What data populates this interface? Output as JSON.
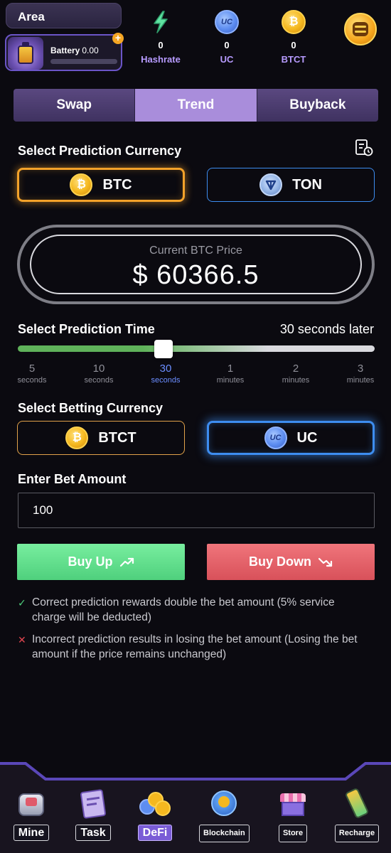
{
  "header": {
    "area_label": "Area",
    "battery_label": "Battery",
    "battery_value": "0.00",
    "stats": [
      {
        "value": "0",
        "label": "Hashrate",
        "icon": "hashrate-bolt-icon"
      },
      {
        "value": "0",
        "label": "UC",
        "icon": "uc-coin-icon",
        "coin_text": "UC"
      },
      {
        "value": "0",
        "label": "BTCT",
        "icon": "btct-coin-icon",
        "coin_text": "₿"
      }
    ],
    "accent_color": "#b79bff"
  },
  "tabs": [
    {
      "label": "Swap",
      "active": false
    },
    {
      "label": "Trend",
      "active": true
    },
    {
      "label": "Buyback",
      "active": false
    }
  ],
  "prediction_currency": {
    "title": "Select Prediction Currency",
    "options": [
      {
        "label": "BTC",
        "coin_text": "₿",
        "selected": true
      },
      {
        "label": "TON",
        "selected": false
      }
    ]
  },
  "price": {
    "label": "Current BTC Price",
    "value": "$ 60366.5"
  },
  "prediction_time": {
    "title": "Select Prediction Time",
    "selected_text": "30 seconds later",
    "selected_index": 2,
    "ticks": [
      {
        "n": "5",
        "u": "seconds"
      },
      {
        "n": "10",
        "u": "seconds"
      },
      {
        "n": "30",
        "u": "seconds"
      },
      {
        "n": "1",
        "u": "minutes"
      },
      {
        "n": "2",
        "u": "minutes"
      },
      {
        "n": "3",
        "u": "minutes"
      }
    ]
  },
  "betting_currency": {
    "title": "Select Betting Currency",
    "options": [
      {
        "label": "BTCT",
        "coin_text": "₿",
        "selected": false
      },
      {
        "label": "UC",
        "coin_text": "UC",
        "selected": true
      }
    ]
  },
  "bet": {
    "title": "Enter Bet Amount",
    "value": "100"
  },
  "actions": {
    "up_label": "Buy Up",
    "down_label": "Buy Down",
    "up_color": "#4fd07d",
    "down_color": "#d8515a"
  },
  "rules": [
    {
      "mark": "✓",
      "text": "Correct prediction rewards double the bet amount (5% service charge will be deducted)"
    },
    {
      "mark": "✕",
      "text": "Incorrect prediction results in losing the bet amount (Losing the bet amount if the price remains unchanged)"
    }
  ],
  "nav": [
    {
      "label": "Mine",
      "icon": "mine-icon",
      "active": false
    },
    {
      "label": "Task",
      "icon": "task-icon",
      "active": false
    },
    {
      "label": "DeFi",
      "icon": "defi-icon",
      "active": true
    },
    {
      "label": "Blockchain",
      "icon": "blockchain-icon",
      "active": false
    },
    {
      "label": "Store",
      "icon": "store-icon",
      "active": false
    },
    {
      "label": "Recharge",
      "icon": "recharge-icon",
      "active": false
    }
  ]
}
